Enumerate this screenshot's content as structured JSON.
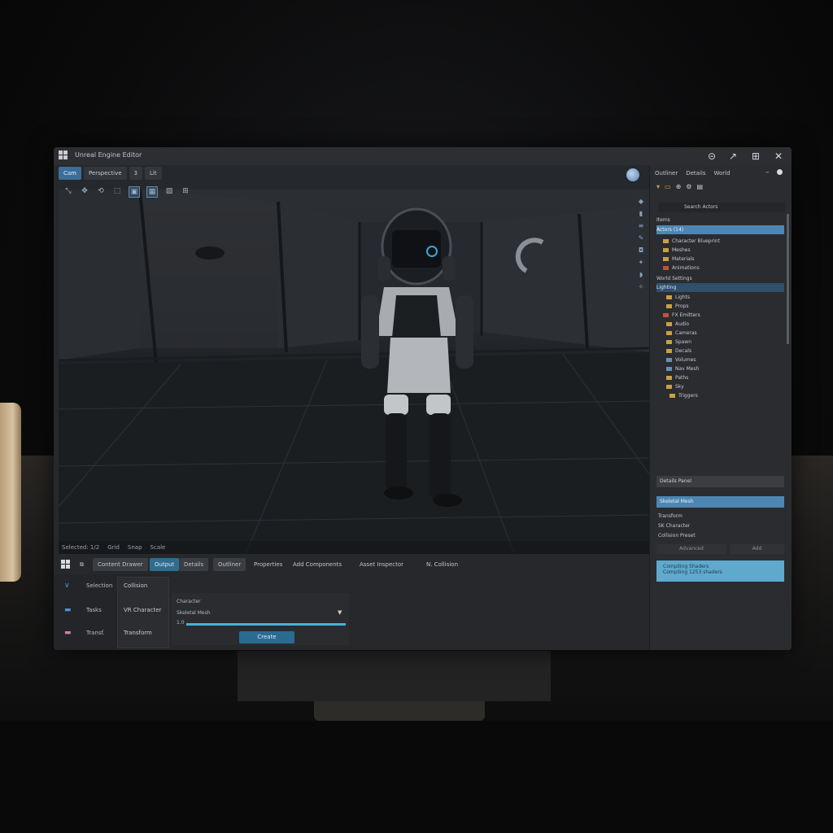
{
  "window": {
    "title": "Unreal Engine Editor",
    "controls": [
      "minimize",
      "restore",
      "maximize",
      "close"
    ]
  },
  "viewport": {
    "toolbar": [
      "Cam",
      "Perspective",
      "3",
      "Lit"
    ],
    "toolbar_active": "Cam",
    "status": [
      "Selected: 1/2",
      "Grid",
      "Snap",
      "Scale"
    ]
  },
  "bottom_tabs": [
    {
      "label": "Content Drawer",
      "state": "normal"
    },
    {
      "label": "Output",
      "state": "active"
    },
    {
      "label": "Details",
      "state": "dim"
    },
    {
      "label": "Outliner",
      "state": "dim"
    },
    {
      "label": "Properties",
      "state": "normal"
    },
    {
      "label": "Add Components",
      "state": "normal"
    },
    {
      "label": "Asset Inspector",
      "state": "normal"
    },
    {
      "label": "N. Collision",
      "state": "normal"
    }
  ],
  "side_panel": {
    "rows": [
      {
        "label": "Selection",
        "color": "#4f8fd0",
        "glyph": "V"
      },
      {
        "label": "Tasks",
        "color": "#4f8fd0",
        "glyph": "■"
      },
      {
        "label": "Transf.",
        "color": "#d07fb0",
        "glyph": "■"
      }
    ],
    "values": [
      "Collision",
      "VR Character",
      "Transform"
    ]
  },
  "props": {
    "field1": "Character",
    "field2": "Skeletal Mesh",
    "field3": "1.0",
    "create_label": "Create"
  },
  "outliner": {
    "tabs": [
      "Outliner",
      "Details",
      "World"
    ],
    "search": "Search Actors",
    "items": [
      {
        "label": "Items",
        "kind": "header"
      },
      {
        "label": "Actors (14)",
        "kind": "selected"
      },
      {
        "label": "Character Blueprint",
        "kind": "folder"
      },
      {
        "label": "Meshes",
        "kind": "folder"
      },
      {
        "label": "Materials",
        "kind": "folder"
      },
      {
        "label": "Animations",
        "kind": "red"
      },
      {
        "label": "World Settings",
        "kind": "header"
      },
      {
        "label": "Lighting",
        "kind": "selected2"
      },
      {
        "label": "Lights",
        "kind": "folder"
      },
      {
        "label": "Props",
        "kind": "folder"
      },
      {
        "label": "FX Emitters",
        "kind": "red"
      },
      {
        "label": "Audio",
        "kind": "folder"
      },
      {
        "label": "Cameras",
        "kind": "folder"
      },
      {
        "label": "Spawn",
        "kind": "folder"
      },
      {
        "label": "Decals",
        "kind": "folder"
      },
      {
        "label": "Volumes",
        "kind": "blue"
      },
      {
        "label": "Nav Mesh",
        "kind": "blue"
      },
      {
        "label": "Paths",
        "kind": "folder"
      },
      {
        "label": "Sky",
        "kind": "folder"
      },
      {
        "label": "Triggers",
        "kind": "folder"
      }
    ],
    "details_header": "Details Panel",
    "details_selected": "Skeletal Mesh",
    "detail_lines": [
      "Transform",
      "SK Character",
      "Collision Preset"
    ],
    "buttons": [
      "Advanced",
      "Add"
    ],
    "info_title": "Compiling Shaders",
    "info_sub": "Compiling 1253 shaders"
  },
  "colors": {
    "accent": "#4d86b2",
    "active_tab": "#2f6d8f",
    "folder": "#c8a046",
    "info_box": "#5fa9cd"
  }
}
